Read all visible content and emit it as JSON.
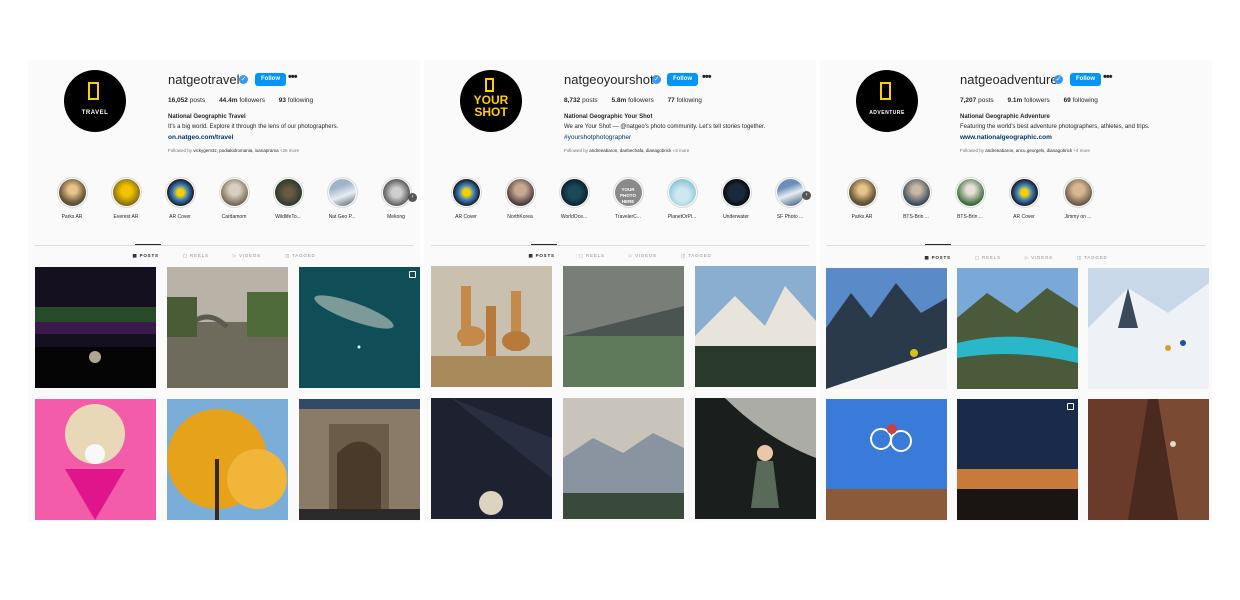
{
  "profiles": [
    {
      "username": "natgeotravel",
      "avatar_text": "TRAVEL",
      "follow_label": "Follow",
      "posts_count": "16,052",
      "followers_count": "44.4m",
      "following_count": "93",
      "posts_word": "posts",
      "followers_word": "followers",
      "following_word": "following",
      "display_name": "National Geographic Travel",
      "bio": "It's a big world. Explore it through the lens of our photographers.",
      "link": "on.natgeo.com/travel",
      "followed_by_prefix": "Followed by",
      "followed_by_names": "vickygem3z, podiakidromania, ioanaprama",
      "followed_by_more": "+26 more",
      "highlights": [
        "Parks AR",
        "Everest AR",
        "AR Cover",
        "Cardamom",
        "WildlifeTo...",
        "Nat Geo P...",
        "Mekong"
      ],
      "tabs": [
        "POSTS",
        "REELS",
        "VIDEOS",
        "TAGGED"
      ]
    },
    {
      "username": "natgeoyourshot",
      "avatar_text_1": "YOUR",
      "avatar_text_2": "SHOT",
      "follow_label": "Follow",
      "posts_count": "8,732",
      "followers_count": "5.8m",
      "following_count": "77",
      "posts_word": "posts",
      "followers_word": "followers",
      "following_word": "following",
      "display_name": "National Geographic Your Shot",
      "bio": "We are Your Shot — @natgeo's photo community. Let's tell stories together.",
      "bio_tag": "#yourshotphotographer",
      "followed_by_prefix": "Followed by",
      "followed_by_names": "andreeabaron, danbechafa, dianagobrick",
      "followed_by_more": "+3 more",
      "highlight_text_yourphoto": "YOUR PHOTO HERE",
      "highlights": [
        "AR Cover",
        "NorthKorea",
        "WorldOce...",
        "TravelerC...",
        "PlanetOrPl...",
        "Underwater",
        "SF Photo ..."
      ],
      "tabs": [
        "POSTS",
        "REELS",
        "VIDEOS",
        "TAGGED"
      ]
    },
    {
      "username": "natgeoadventure",
      "avatar_text": "ADVENTURE",
      "follow_label": "Follow",
      "posts_count": "7,207",
      "followers_count": "9.1m",
      "following_count": "69",
      "posts_word": "posts",
      "followers_word": "followers",
      "following_word": "following",
      "display_name": "National Geographic Adventure",
      "bio": "Featuring the world's best adventure photographers, athletes, and trips.",
      "link": "www.nationalgeographic.com",
      "followed_by_prefix": "Followed by",
      "followed_by_names": "andreeabaron, ancu.georgels, dianagobrick",
      "followed_by_more": "+4 more",
      "highlights": [
        "Parks AR",
        "BTS-Brin ...",
        "BTS-Brin ...",
        "AR Cover",
        "Jimmy on ..."
      ],
      "tabs": [
        "POSTS",
        "REELS",
        "VIDEOS",
        "TAGGED"
      ]
    }
  ],
  "colors": {
    "follow_blue": "#0095f6",
    "verified_blue": "#3897f0",
    "natgeo_yellow": "#ffce00",
    "link_blue": "#00376b"
  },
  "icons": [
    "verified-badge-icon",
    "more-options-icon",
    "grid-icon",
    "reels-icon",
    "videos-icon",
    "tagged-icon",
    "multi-post-icon",
    "chevron-right-icon"
  ]
}
